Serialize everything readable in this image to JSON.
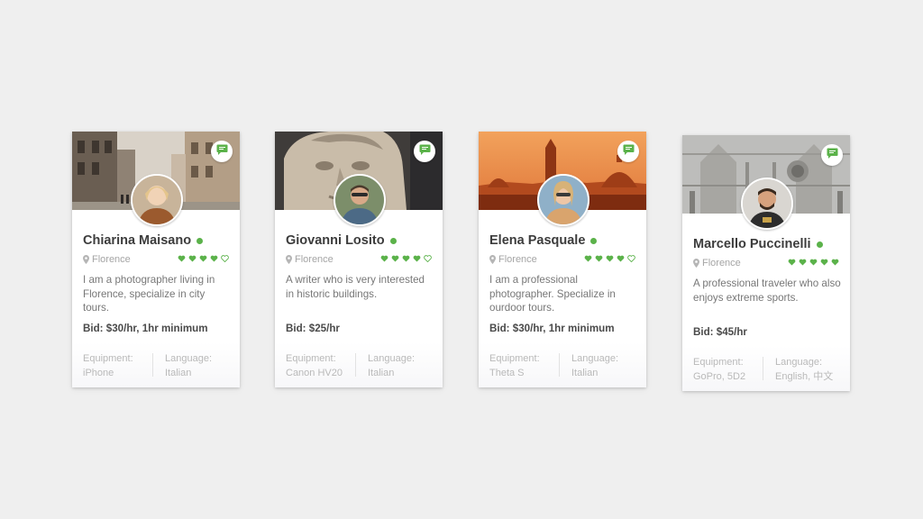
{
  "colors": {
    "accent_green": "#5bb24a",
    "background": "#efefef"
  },
  "icons": {
    "chat": "chat-bubble-icon",
    "location": "location-pin-icon",
    "rating": "heart-icon"
  },
  "cards": [
    {
      "name": "Chiarina Maisano",
      "location": "Florence",
      "rating": 4,
      "rating_max": 5,
      "description": "I am a photographer living in Florence, specialize in city tours.",
      "bid": "Bid: $30/hr, 1hr minimum",
      "equipment_label": "Equipment:",
      "equipment_value": "iPhone",
      "language_label": "Language:",
      "language_value": "Italian"
    },
    {
      "name": "Giovanni Losito",
      "location": "Florence",
      "rating": 4,
      "rating_max": 5,
      "description": "A writer who is very interested in historic buildings.",
      "bid": "Bid: $25/hr",
      "equipment_label": "Equipment:",
      "equipment_value": "Canon HV20",
      "language_label": "Language:",
      "language_value": "Italian"
    },
    {
      "name": "Elena Pasquale",
      "location": "Florence",
      "rating": 4,
      "rating_max": 5,
      "description": "I am a professional photographer. Specialize in ourdoor tours.",
      "bid": "Bid: $30/hr, 1hr minimum",
      "equipment_label": "Equipment:",
      "equipment_value": "Theta S",
      "language_label": "Language:",
      "language_value": "Italian"
    },
    {
      "name": "Marcello Puccinelli",
      "location": "Florence",
      "rating": 5,
      "rating_max": 5,
      "description": "A professional traveler who also enjoys extreme sports.",
      "bid": "Bid: $45/hr",
      "equipment_label": "Equipment:",
      "equipment_value": "GoPro, 5D2",
      "language_label": "Language:",
      "language_value": "English, 中文"
    }
  ]
}
